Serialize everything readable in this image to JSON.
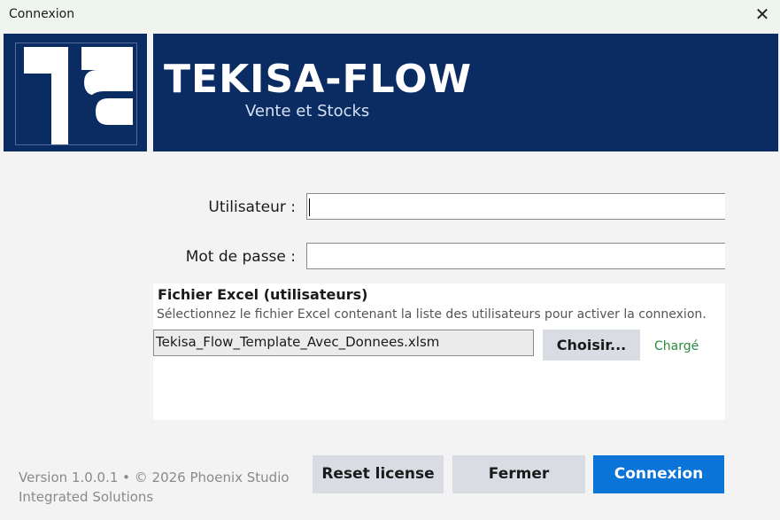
{
  "window": {
    "title": "Connexion",
    "close_icon": "close-icon"
  },
  "header": {
    "brand": "TEKISA-FLOW",
    "subtitle": "Vente et Stocks",
    "color": "#0b2b63"
  },
  "form": {
    "user_label": "Utilisateur :",
    "user_value": "",
    "password_label": "Mot de passe :",
    "password_value": ""
  },
  "excel": {
    "title": "Fichier Excel (utilisateurs)",
    "description": "Sélectionnez le fichier Excel contenant la liste des utilisateurs pour activer la connexion.",
    "file_name": "Tekisa_Flow_Template_Avec_Donnees.xlsm",
    "choose_label": "Choisir...",
    "status": "Chargé",
    "status_color": "#2b8a3e"
  },
  "footer": {
    "version_line1": "Version 1.0.0.1  •  © 2026 Phoenix Studio",
    "version_line2": "Integrated Solutions"
  },
  "buttons": {
    "reset": "Reset license",
    "close": "Fermer",
    "login": "Connexion",
    "primary_color": "#0b74d8"
  }
}
